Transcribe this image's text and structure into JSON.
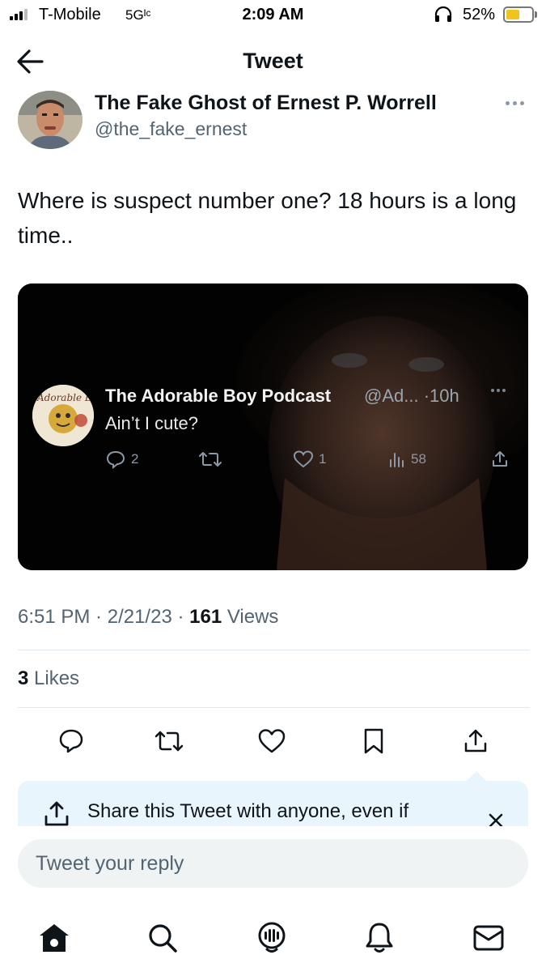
{
  "status_bar": {
    "carrier": "T-Mobile",
    "network": "5Gᴵᶜ",
    "time": "2:09 AM",
    "battery_percent": "52%",
    "battery_level": 0.52
  },
  "nav": {
    "title": "Tweet",
    "back_icon": "arrow-left-icon"
  },
  "tweet": {
    "author_name": "The Fake Ghost of Ernest P. Worrell",
    "author_handle": "@the_fake_ernest",
    "text": "Where is suspect number one? 18 hours is a long time..",
    "embedded": {
      "author_name": "The Adorable Boy Podcast",
      "meta": "@Ad... ·10h",
      "text": "Ain’t I cute?",
      "avatar_text": "Adorable Boy",
      "replies": "2",
      "likes": "1",
      "views": "58"
    },
    "time": "6:51 PM",
    "date": "2/21/23",
    "views_count": "161",
    "views_label": "Views",
    "likes_count": "3",
    "likes_label": "Likes"
  },
  "share_tip": {
    "text": "Share this Tweet with anyone, even if"
  },
  "reply": {
    "placeholder": "Tweet your reply"
  },
  "tabbar": {
    "items": [
      "home-icon",
      "search-icon",
      "spaces-icon",
      "notifications-icon",
      "messages-icon"
    ]
  },
  "colors": {
    "text": "#0f1419",
    "secondary": "#536471",
    "tooltip_bg": "#e8f5fd",
    "input_bg": "#eff3f4",
    "battery": "#f2c31b"
  }
}
